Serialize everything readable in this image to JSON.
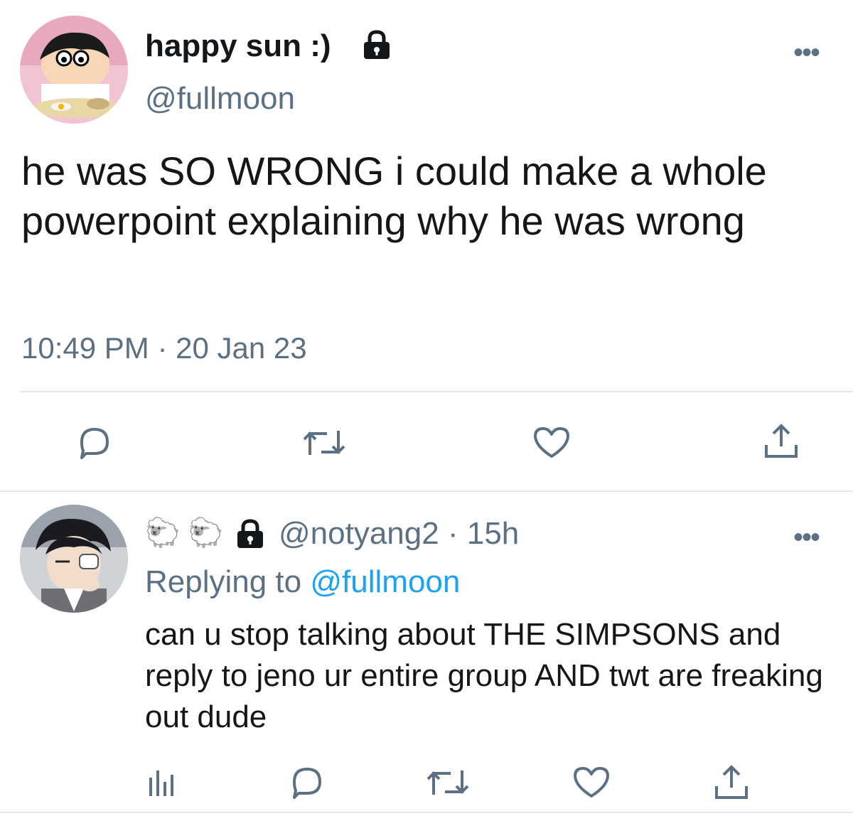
{
  "main_tweet": {
    "display_name": "happy sun :)",
    "handle": "@fullmoon",
    "text": "he was SO WRONG i could make a whole powerpoint explaining why he was wrong",
    "time": "10:49 PM",
    "separator": "·",
    "date": "20 Jan 23",
    "more": "•••",
    "avatar_icon": "cartoon-boy-avatar",
    "lock_icon": "lock-icon"
  },
  "reply": {
    "display_name_emoji": "🐑 🐑",
    "handle": "@notyang2",
    "separator": "·",
    "age": "15h",
    "more": "•••",
    "replying_prefix": "Replying to",
    "replying_handle": "@fullmoon",
    "text": "can u stop talking about THE SIMPSONS and reply to jeno ur entire group AND twt are freaking out dude",
    "avatar_icon": "anime-character-avatar"
  },
  "colors": {
    "text": "#14171a",
    "secondary": "#5b7083",
    "link": "#1da1f2",
    "divider": "#e1e8ed"
  },
  "actions": [
    "reply-icon",
    "retweet-icon",
    "like-icon",
    "share-icon",
    "analytics-icon"
  ]
}
